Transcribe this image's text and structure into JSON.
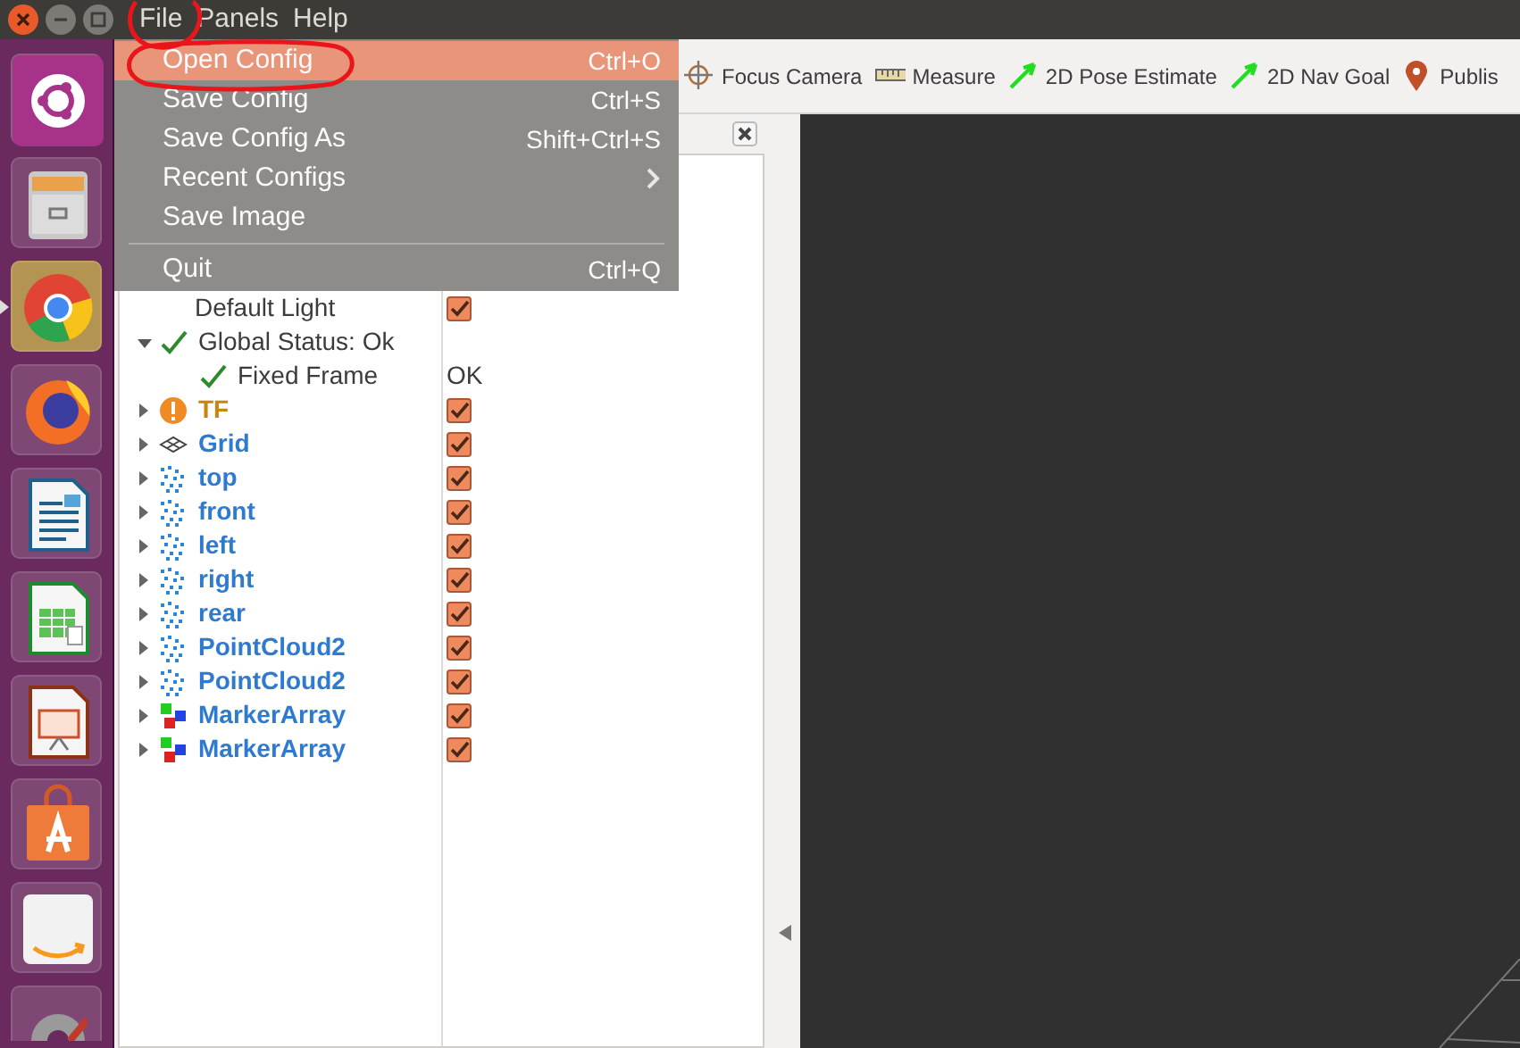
{
  "menubar": [
    {
      "label": "File"
    },
    {
      "label": "Panels"
    },
    {
      "label": "Help"
    }
  ],
  "file_menu": [
    {
      "label": "Open Config",
      "shortcut": "Ctrl+O",
      "selected": true
    },
    {
      "label": "Save Config",
      "shortcut": "Ctrl+S",
      "selected": false
    },
    {
      "label": "Save Config As",
      "shortcut": "Shift+Ctrl+S",
      "selected": false
    },
    {
      "label": "Recent Configs",
      "submenu": true,
      "selected": false
    },
    {
      "label": "Save Image",
      "selected": false
    },
    {
      "label": "Quit",
      "shortcut": "Ctrl+Q",
      "separator_before": true,
      "selected": false
    }
  ],
  "launcher": [
    {
      "kind": "logo",
      "selected": false
    },
    {
      "kind": "cabinet",
      "selected": false
    },
    {
      "kind": "browser",
      "selected": true
    },
    {
      "kind": "fox",
      "selected": false
    },
    {
      "kind": "writer",
      "selected": false
    },
    {
      "kind": "sheet",
      "selected": false
    },
    {
      "kind": "slides",
      "selected": false
    },
    {
      "kind": "bag",
      "selected": false
    },
    {
      "kind": "store",
      "selected": false
    },
    {
      "kind": "settings",
      "selected": false
    }
  ],
  "toolbar": [
    {
      "label": "Focus Camera",
      "kind": "focus",
      "selected": false
    },
    {
      "label": "Measure",
      "kind": "measure",
      "selected": false
    },
    {
      "label": "2D Pose Estimate",
      "kind": "pose",
      "selected": false
    },
    {
      "label": "2D Nav Goal",
      "kind": "nav",
      "selected": false
    },
    {
      "label": "Publis",
      "kind": "point",
      "selected": false
    }
  ],
  "displays": {
    "tree": [
      {
        "children": [
          {
            "label": "Default Light",
            "checked": true
          }
        ]
      },
      {
        "label": "Global Status: Ok",
        "kind": "status_ok",
        "expanded": true,
        "children": [
          {
            "label": "Fixed Frame",
            "kind": "status_ok",
            "value": "OK"
          }
        ]
      },
      {
        "label": "TF",
        "kind": "tf",
        "warning": true,
        "expanded": false,
        "checked": true
      },
      {
        "label": "Grid",
        "kind": "grid",
        "warning": false,
        "expanded": false,
        "checked": true
      },
      {
        "label": "top",
        "kind": "cloud",
        "warning": false,
        "expanded": false,
        "checked": true
      },
      {
        "label": "front",
        "kind": "cloud",
        "warning": false,
        "expanded": false,
        "checked": true
      },
      {
        "label": "left",
        "kind": "cloud",
        "warning": false,
        "expanded": false,
        "checked": true
      },
      {
        "label": "right",
        "kind": "cloud",
        "warning": false,
        "expanded": false,
        "checked": true
      },
      {
        "label": "rear",
        "kind": "cloud",
        "warning": false,
        "expanded": false,
        "checked": true
      },
      {
        "label": "PointCloud2",
        "kind": "cloud",
        "warning": false,
        "expanded": false,
        "checked": true
      },
      {
        "label": "PointCloud2",
        "kind": "cloud",
        "warning": false,
        "expanded": false,
        "checked": true
      },
      {
        "label": "MarkerArray",
        "kind": "marker",
        "warning": false,
        "expanded": false,
        "checked": true
      },
      {
        "label": "MarkerArray",
        "kind": "marker",
        "warning": false,
        "expanded": false,
        "checked": true
      }
    ]
  }
}
